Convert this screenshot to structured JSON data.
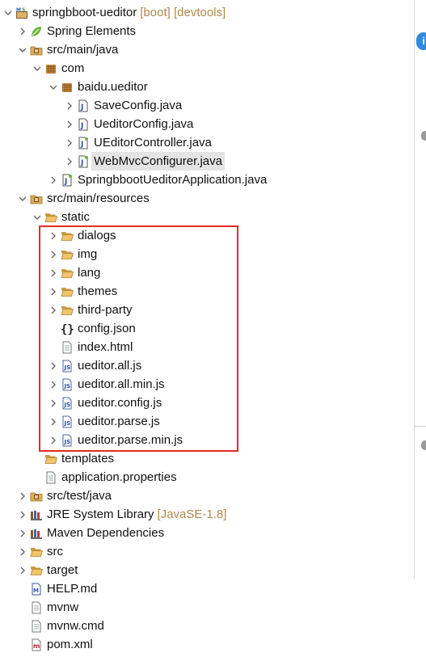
{
  "project": {
    "name": "springbboot-ueditor",
    "decorations": "[boot] [devtools]"
  },
  "tree": [
    {
      "label": "Spring Elements"
    },
    {
      "label": "src/main/java"
    },
    {
      "label": "com"
    },
    {
      "label": "baidu.ueditor"
    },
    {
      "label": "SaveConfig.java"
    },
    {
      "label": "UeditorConfig.java"
    },
    {
      "label": "UEditorController.java"
    },
    {
      "label": "WebMvcConfigurer.java"
    },
    {
      "label": "SpringbbootUeditorApplication.java"
    },
    {
      "label": "src/main/resources"
    },
    {
      "label": "static"
    },
    {
      "label": "dialogs"
    },
    {
      "label": "img"
    },
    {
      "label": "lang"
    },
    {
      "label": "themes"
    },
    {
      "label": "third-party"
    },
    {
      "label": "config.json"
    },
    {
      "label": "index.html"
    },
    {
      "label": "ueditor.all.js"
    },
    {
      "label": "ueditor.all.min.js"
    },
    {
      "label": "ueditor.config.js"
    },
    {
      "label": "ueditor.parse.js"
    },
    {
      "label": "ueditor.parse.min.js"
    },
    {
      "label": "templates"
    },
    {
      "label": "application.properties"
    },
    {
      "label": "src/test/java"
    },
    {
      "label": "JRE System Library",
      "decoration": "[JavaSE-1.8]"
    },
    {
      "label": "Maven Dependencies"
    },
    {
      "label": "src"
    },
    {
      "label": "target"
    },
    {
      "label": "HELP.md"
    },
    {
      "label": "mvnw"
    },
    {
      "label": "mvnw.cmd"
    },
    {
      "label": "pom.xml"
    }
  ],
  "icons": {
    "project": "maven-boot-project-icon",
    "spring": "spring-leaf-icon",
    "source_folder": "source-folder-icon",
    "package": "package-icon",
    "java": "java-file-icon",
    "folder": "folder-icon",
    "json": "json-braces-icon",
    "file": "text-file-icon",
    "js": "js-file-icon",
    "library": "library-icon"
  },
  "highlight_color": "#e12b2b",
  "edge_info": "i"
}
